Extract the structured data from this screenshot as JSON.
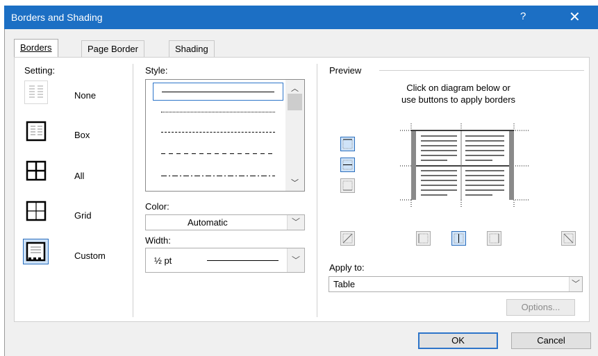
{
  "window": {
    "title": "Borders and Shading",
    "help_glyph": "?",
    "close_glyph": "✕"
  },
  "tabs": [
    {
      "label": "Borders",
      "active": true
    },
    {
      "label": "Page Border",
      "active": false
    },
    {
      "label": "Shading",
      "active": false
    }
  ],
  "setting": {
    "label": "Setting:",
    "items": [
      {
        "label": "None",
        "icon": "setting-none-icon"
      },
      {
        "label": "Box",
        "icon": "setting-box-icon"
      },
      {
        "label": "All",
        "icon": "setting-all-icon"
      },
      {
        "label": "Grid",
        "icon": "setting-grid-icon"
      },
      {
        "label": "Custom",
        "icon": "setting-custom-icon",
        "selected": true
      }
    ]
  },
  "style": {
    "label": "Style:",
    "options": [
      "solid",
      "dotted",
      "dashed-small",
      "dashed",
      "dash-dot"
    ],
    "selected": "solid"
  },
  "color": {
    "label": "Color:",
    "value": "Automatic"
  },
  "width": {
    "label": "Width:",
    "value": "½ pt"
  },
  "preview": {
    "label": "Preview",
    "instructions_line1": "Click on diagram below or",
    "instructions_line2": "use buttons to apply borders"
  },
  "apply_to": {
    "label": "Apply to:",
    "value": "Table"
  },
  "buttons": {
    "options": "Options...",
    "ok": "OK",
    "cancel": "Cancel"
  },
  "colors": {
    "titlebar": "#1c6fc4",
    "selection": "#cfe3f8",
    "accent": "#2c74c9"
  }
}
